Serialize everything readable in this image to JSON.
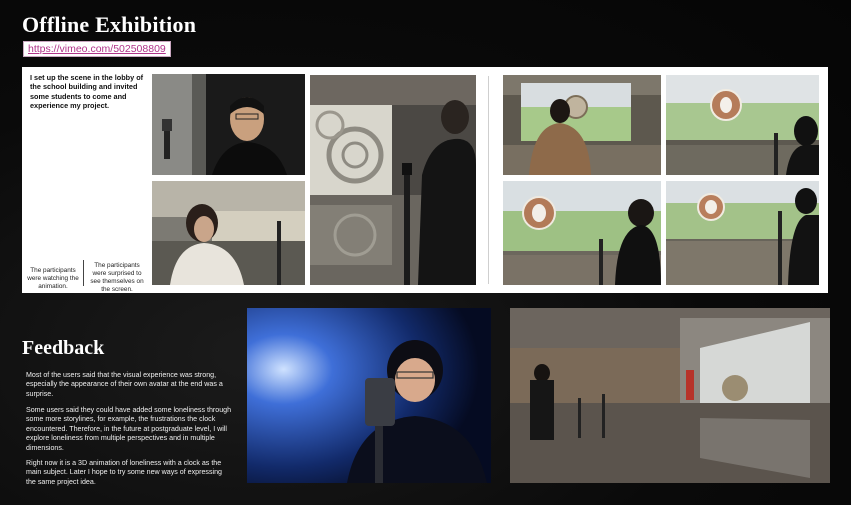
{
  "header": {
    "title": "Offline Exhibition",
    "link": "https://vimeo.com/502508809"
  },
  "exhibit": {
    "intro": "I set up the scene in the lobby of the school building and invited some students to come and experience my project.",
    "caption_left": "The participants were watching the animation.",
    "caption_right": "The participants were surprised to see themselves on the screen."
  },
  "feedback": {
    "title": "Feedback",
    "paragraphs": [
      "Most of the users said that the visual experience was strong, especially the appearance of their own avatar at the end was a surprise.",
      "Some users said they could have added some loneliness through some more storylines, for example, the frustrations the clock encountered. Therefore, in the future at postgraduate level, I will explore loneliness from multiple perspectives and in multiple dimensions.",
      "Right now it is a 3D animation of loneliness with a clock as the main subject. Later I hope to try some new ways of expressing the same project idea."
    ]
  },
  "colors": {
    "link_text": "#b0338a",
    "panel_bg": "#ffffff",
    "page_bg": "#0a0a0a"
  }
}
